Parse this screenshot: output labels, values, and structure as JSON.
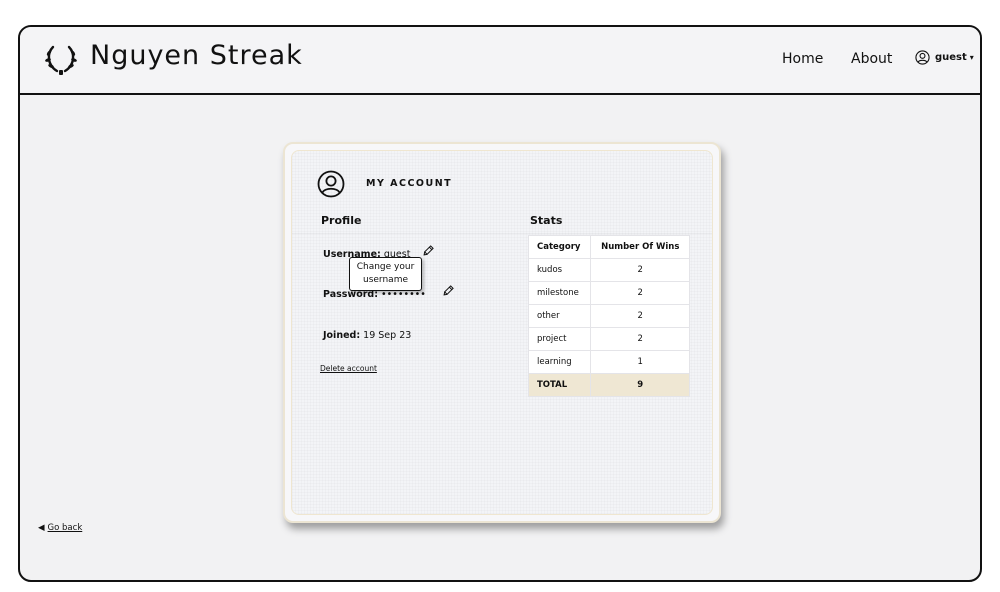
{
  "header": {
    "brand": "Nguyen Streak",
    "logo_icon": "laurel-wreath-icon",
    "nav": {
      "home": "Home",
      "about": "About"
    },
    "user": {
      "icon": "user-circle-icon",
      "name": "guest",
      "caret": "▾"
    }
  },
  "card": {
    "title": "MY ACCOUNT",
    "title_icon": "user-circle-icon",
    "profile": {
      "heading": "Profile",
      "username_label": "Username:",
      "username_value": "guest",
      "password_label": "Password:",
      "password_value": "••••••••",
      "joined_label": "Joined:",
      "joined_value": "19 Sep 23",
      "tooltip_line1": "Change your",
      "tooltip_line2": "username",
      "delete_label": "Delete account",
      "edit_icon": "pencil-icon"
    },
    "stats": {
      "heading": "Stats",
      "columns": [
        "Category",
        "Number Of Wins"
      ],
      "rows": [
        {
          "category": "kudos",
          "wins": "2"
        },
        {
          "category": "milestone",
          "wins": "2"
        },
        {
          "category": "other",
          "wins": "2"
        },
        {
          "category": "project",
          "wins": "2"
        },
        {
          "category": "learning",
          "wins": "1"
        }
      ],
      "total": {
        "category": "TOTAL",
        "wins": "9"
      }
    }
  },
  "footer": {
    "go_back": "Go back",
    "go_back_icon": "triangle-left-icon"
  },
  "colors": {
    "frame_bg": "#f2f2f3",
    "total_row": "#efe7d3",
    "card_border": "#ece5d3"
  }
}
